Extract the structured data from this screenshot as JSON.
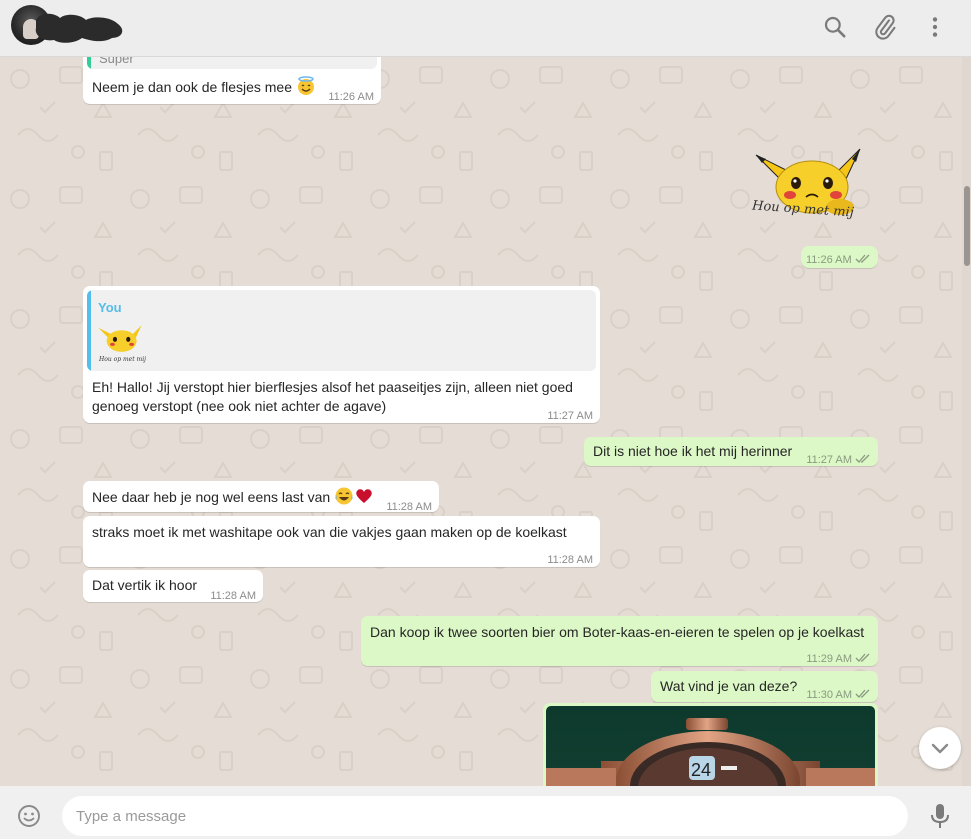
{
  "header": {
    "icons": [
      "search-icon",
      "paperclip-icon",
      "menu-dots-icon"
    ]
  },
  "messages": {
    "m1": {
      "quote_fragment": "Super",
      "text": "Neem je dan ook de flesjes mee",
      "emoji": "smiling-face-with-halo",
      "time": "11:26 AM"
    },
    "m2": {
      "sticker_caption": "Hou op met mij",
      "time": "11:26 AM"
    },
    "m3": {
      "quote_author": "You",
      "quote_sticker_caption": "Hou op met mij",
      "text_line1": "Eh! Hallo! Jij verstopt hier bierflesjes alsof het paaseitjes zijn, alleen niet goed",
      "text_line2": "genoeg verstopt (nee ook niet achter de agave)",
      "time": "11:27 AM"
    },
    "m4": {
      "text": "Dit is niet hoe ik het mij herinner",
      "time": "11:27 AM"
    },
    "m5": {
      "text": "Nee daar heb je nog wel eens last van",
      "emojis": [
        "face-with-tears-of-joy",
        "red-heart"
      ],
      "time": "11:28 AM"
    },
    "m6": {
      "text": "straks moet ik met washitape ook van die vakjes gaan maken op de koelkast",
      "time": "11:28 AM"
    },
    "m7": {
      "text": "Dat vertik ik hoor",
      "time": "11:28 AM"
    },
    "m8": {
      "text": "Dan koop ik twee soorten bier om Boter-kaas-en-eieren te spelen op je koelkast",
      "time": "11:29 AM"
    },
    "m9": {
      "text": "Wat vind je van deze?",
      "time": "11:30 AM"
    },
    "m10": {
      "image": "watch-photo"
    }
  },
  "composer": {
    "placeholder": "Type a message",
    "icons": [
      "emoji-icon",
      "microphone-icon"
    ]
  },
  "colors": {
    "background": "#e5ddd5",
    "incoming_bubble": "#ffffff",
    "outgoing_bubble": "#dcf8c6",
    "read_ticks": "#4fc3f7",
    "quote_author": "#53bdeb"
  }
}
